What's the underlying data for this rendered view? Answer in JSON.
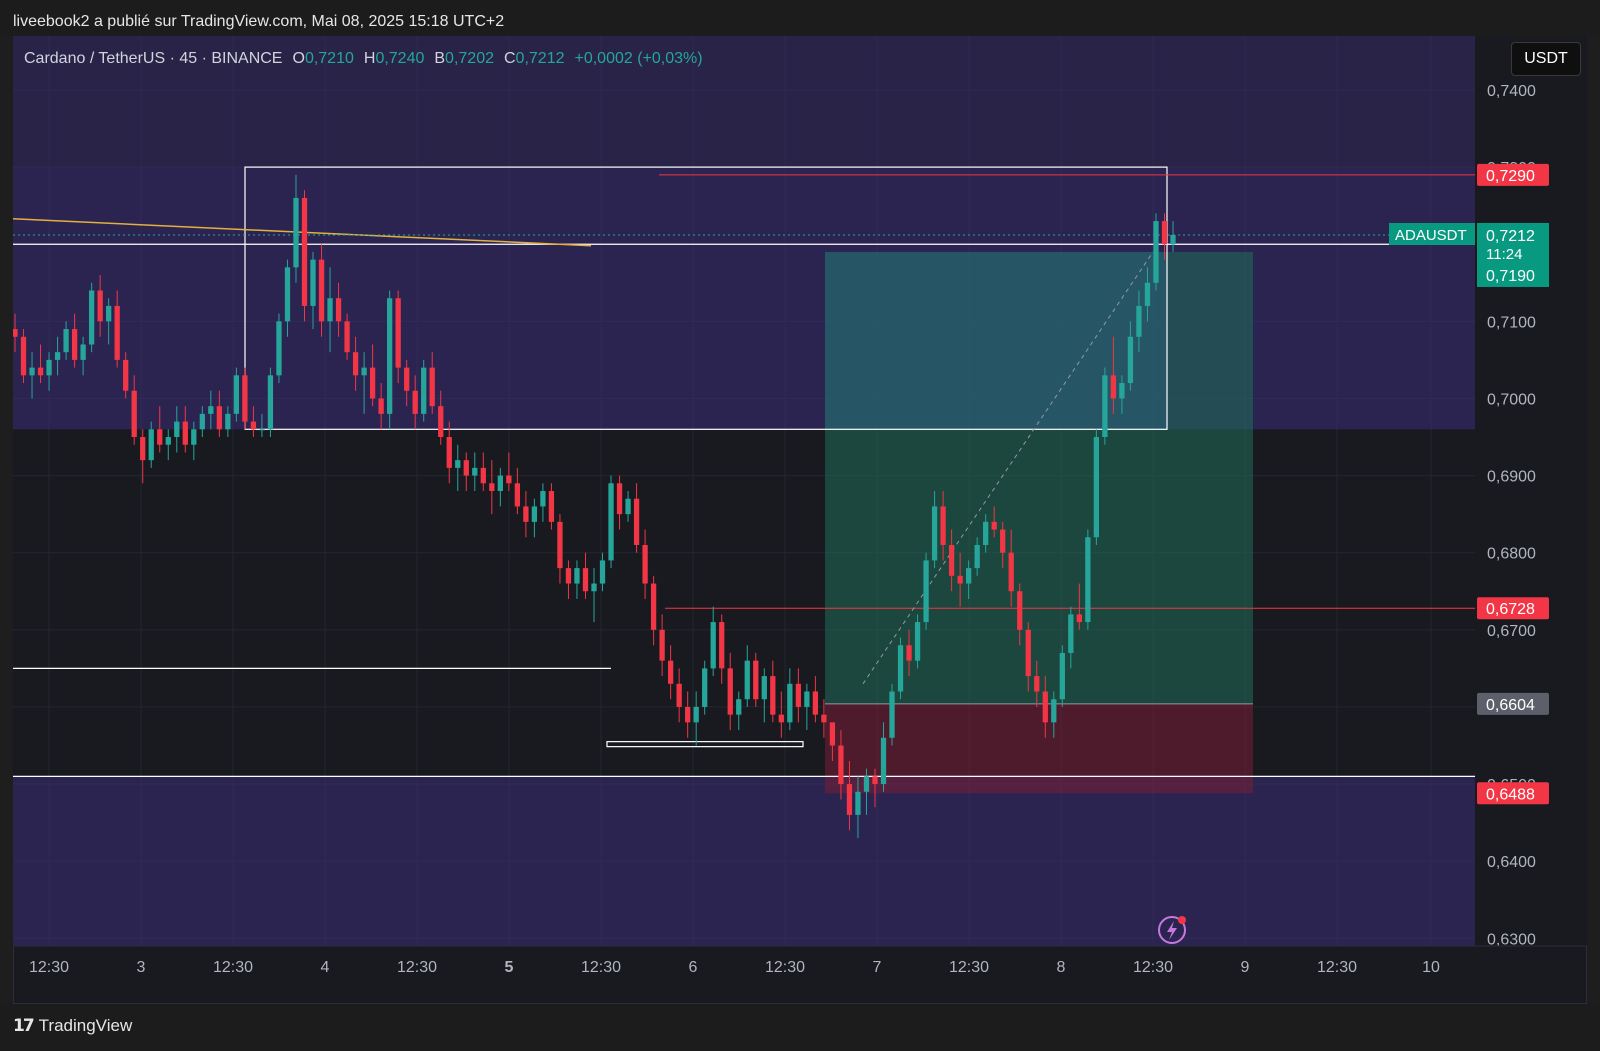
{
  "header": {
    "publisher_line": "liveebook2 a publié sur TradingView.com, Mai 08, 2025 15:18 UTC+2"
  },
  "legend": {
    "symbol": "Cardano / TetherUS · 45 · BINANCE",
    "open_label": "O",
    "open": "0,7210",
    "high_label": "H",
    "high": "0,7240",
    "low_label": "B",
    "low": "0,7202",
    "close_label": "C",
    "close": "0,7212",
    "change": "+0,0002 (+0,03%)"
  },
  "currency_button": "USDT",
  "footer": {
    "brand": "TradingView"
  },
  "colors": {
    "up": "#26a69a",
    "down": "#f23645",
    "zone_purple": "#3d2e7a",
    "tp_green": "#1f6e58",
    "sl_red": "#7a1e35"
  },
  "chart_data": {
    "type": "candlestick",
    "symbol": "ADAUSDT",
    "ylim": [
      0.629,
      0.747
    ],
    "y_ticks": [
      "0,7400",
      "0,7300",
      "0,7100",
      "0,7000",
      "0,6900",
      "0,6800",
      "0,6700",
      "0,6500",
      "0,6400",
      "0,6300"
    ],
    "x_ticks": [
      "12:30",
      "3",
      "12:30",
      "4",
      "12:30",
      "5",
      "12:30",
      "6",
      "12:30",
      "7",
      "12:30",
      "8",
      "12:30",
      "9",
      "12:30",
      "10"
    ],
    "bold_x_ticks": [
      "5"
    ],
    "price_labels": [
      {
        "text": "0,7290",
        "value": 0.729,
        "style": "red"
      },
      {
        "text": "0,6728",
        "value": 0.6728,
        "style": "red"
      },
      {
        "text": "0,6604",
        "value": 0.6604,
        "style": "gray"
      },
      {
        "text": "0,6488",
        "value": 0.6488,
        "style": "red"
      }
    ],
    "current": {
      "symbol_label": "ADAUSDT",
      "price": "0,7212",
      "value": 0.7212,
      "countdown": "11:24",
      "bid": "0,7190"
    },
    "candles": [
      [
        0.709,
        0.711,
        0.706,
        0.708
      ],
      [
        0.708,
        0.709,
        0.702,
        0.703
      ],
      [
        0.703,
        0.706,
        0.7,
        0.704
      ],
      [
        0.704,
        0.707,
        0.702,
        0.703
      ],
      [
        0.703,
        0.706,
        0.701,
        0.705
      ],
      [
        0.705,
        0.708,
        0.703,
        0.706
      ],
      [
        0.706,
        0.71,
        0.705,
        0.709
      ],
      [
        0.709,
        0.711,
        0.704,
        0.705
      ],
      [
        0.705,
        0.708,
        0.703,
        0.707
      ],
      [
        0.707,
        0.715,
        0.706,
        0.714
      ],
      [
        0.714,
        0.716,
        0.708,
        0.71
      ],
      [
        0.71,
        0.713,
        0.707,
        0.712
      ],
      [
        0.712,
        0.714,
        0.704,
        0.705
      ],
      [
        0.705,
        0.706,
        0.7,
        0.701
      ],
      [
        0.701,
        0.703,
        0.694,
        0.695
      ],
      [
        0.695,
        0.696,
        0.689,
        0.692
      ],
      [
        0.692,
        0.697,
        0.691,
        0.696
      ],
      [
        0.696,
        0.699,
        0.693,
        0.694
      ],
      [
        0.694,
        0.696,
        0.692,
        0.695
      ],
      [
        0.695,
        0.699,
        0.693,
        0.697
      ],
      [
        0.697,
        0.699,
        0.693,
        0.694
      ],
      [
        0.694,
        0.697,
        0.692,
        0.696
      ],
      [
        0.696,
        0.699,
        0.695,
        0.698
      ],
      [
        0.698,
        0.701,
        0.696,
        0.699
      ],
      [
        0.699,
        0.701,
        0.695,
        0.696
      ],
      [
        0.696,
        0.699,
        0.695,
        0.698
      ],
      [
        0.698,
        0.704,
        0.697,
        0.703
      ],
      [
        0.703,
        0.704,
        0.696,
        0.697
      ],
      [
        0.697,
        0.699,
        0.695,
        0.696
      ],
      [
        0.696,
        0.698,
        0.695,
        0.696
      ],
      [
        0.696,
        0.704,
        0.695,
        0.703
      ],
      [
        0.703,
        0.711,
        0.702,
        0.71
      ],
      [
        0.71,
        0.718,
        0.708,
        0.717
      ],
      [
        0.717,
        0.729,
        0.715,
        0.726
      ],
      [
        0.726,
        0.727,
        0.71,
        0.712
      ],
      [
        0.712,
        0.719,
        0.709,
        0.718
      ],
      [
        0.718,
        0.72,
        0.708,
        0.71
      ],
      [
        0.71,
        0.717,
        0.706,
        0.713
      ],
      [
        0.713,
        0.715,
        0.708,
        0.71
      ],
      [
        0.71,
        0.711,
        0.705,
        0.706
      ],
      [
        0.706,
        0.708,
        0.701,
        0.703
      ],
      [
        0.703,
        0.706,
        0.698,
        0.704
      ],
      [
        0.704,
        0.707,
        0.699,
        0.7
      ],
      [
        0.7,
        0.702,
        0.696,
        0.698
      ],
      [
        0.698,
        0.714,
        0.696,
        0.713
      ],
      [
        0.713,
        0.714,
        0.702,
        0.704
      ],
      [
        0.704,
        0.705,
        0.699,
        0.701
      ],
      [
        0.701,
        0.703,
        0.696,
        0.698
      ],
      [
        0.698,
        0.705,
        0.697,
        0.704
      ],
      [
        0.704,
        0.706,
        0.698,
        0.699
      ],
      [
        0.699,
        0.701,
        0.694,
        0.695
      ],
      [
        0.695,
        0.697,
        0.689,
        0.691
      ],
      [
        0.691,
        0.694,
        0.688,
        0.692
      ],
      [
        0.692,
        0.693,
        0.688,
        0.69
      ],
      [
        0.69,
        0.693,
        0.688,
        0.691
      ],
      [
        0.691,
        0.693,
        0.688,
        0.689
      ],
      [
        0.689,
        0.692,
        0.685,
        0.688
      ],
      [
        0.688,
        0.691,
        0.686,
        0.69
      ],
      [
        0.69,
        0.693,
        0.688,
        0.689
      ],
      [
        0.689,
        0.691,
        0.685,
        0.686
      ],
      [
        0.686,
        0.688,
        0.682,
        0.684
      ],
      [
        0.684,
        0.687,
        0.682,
        0.686
      ],
      [
        0.686,
        0.689,
        0.684,
        0.688
      ],
      [
        0.688,
        0.689,
        0.683,
        0.684
      ],
      [
        0.684,
        0.685,
        0.676,
        0.678
      ],
      [
        0.678,
        0.679,
        0.674,
        0.676
      ],
      [
        0.676,
        0.679,
        0.674,
        0.678
      ],
      [
        0.678,
        0.68,
        0.674,
        0.675
      ],
      [
        0.675,
        0.678,
        0.671,
        0.676
      ],
      [
        0.676,
        0.68,
        0.675,
        0.679
      ],
      [
        0.679,
        0.69,
        0.678,
        0.689
      ],
      [
        0.689,
        0.69,
        0.683,
        0.685
      ],
      [
        0.685,
        0.688,
        0.684,
        0.687
      ],
      [
        0.687,
        0.689,
        0.68,
        0.681
      ],
      [
        0.681,
        0.683,
        0.674,
        0.676
      ],
      [
        0.676,
        0.677,
        0.668,
        0.67
      ],
      [
        0.67,
        0.672,
        0.664,
        0.666
      ],
      [
        0.666,
        0.668,
        0.661,
        0.663
      ],
      [
        0.663,
        0.665,
        0.658,
        0.66
      ],
      [
        0.66,
        0.662,
        0.656,
        0.658
      ],
      [
        0.658,
        0.662,
        0.655,
        0.66
      ],
      [
        0.66,
        0.666,
        0.659,
        0.665
      ],
      [
        0.665,
        0.673,
        0.664,
        0.671
      ],
      [
        0.671,
        0.672,
        0.663,
        0.665
      ],
      [
        0.665,
        0.667,
        0.657,
        0.659
      ],
      [
        0.659,
        0.662,
        0.657,
        0.661
      ],
      [
        0.661,
        0.668,
        0.66,
        0.666
      ],
      [
        0.666,
        0.667,
        0.66,
        0.661
      ],
      [
        0.661,
        0.665,
        0.658,
        0.664
      ],
      [
        0.664,
        0.666,
        0.658,
        0.659
      ],
      [
        0.659,
        0.662,
        0.656,
        0.658
      ],
      [
        0.658,
        0.665,
        0.657,
        0.663
      ],
      [
        0.663,
        0.665,
        0.658,
        0.66
      ],
      [
        0.66,
        0.663,
        0.657,
        0.662
      ],
      [
        0.662,
        0.664,
        0.658,
        0.659
      ],
      [
        0.659,
        0.661,
        0.656,
        0.658
      ],
      [
        0.658,
        0.656,
        0.653,
        0.655
      ],
      [
        0.655,
        0.657,
        0.648,
        0.65
      ],
      [
        0.65,
        0.653,
        0.644,
        0.646
      ],
      [
        0.646,
        0.651,
        0.643,
        0.649
      ],
      [
        0.649,
        0.652,
        0.646,
        0.651
      ],
      [
        0.651,
        0.652,
        0.647,
        0.65
      ],
      [
        0.65,
        0.658,
        0.649,
        0.656
      ],
      [
        0.656,
        0.663,
        0.655,
        0.662
      ],
      [
        0.662,
        0.669,
        0.661,
        0.668
      ],
      [
        0.668,
        0.67,
        0.664,
        0.666
      ],
      [
        0.666,
        0.672,
        0.665,
        0.671
      ],
      [
        0.671,
        0.68,
        0.67,
        0.679
      ],
      [
        0.679,
        0.688,
        0.678,
        0.686
      ],
      [
        0.686,
        0.688,
        0.679,
        0.681
      ],
      [
        0.681,
        0.683,
        0.675,
        0.677
      ],
      [
        0.677,
        0.68,
        0.673,
        0.676
      ],
      [
        0.676,
        0.679,
        0.674,
        0.678
      ],
      [
        0.678,
        0.682,
        0.677,
        0.681
      ],
      [
        0.681,
        0.685,
        0.68,
        0.684
      ],
      [
        0.684,
        0.686,
        0.682,
        0.683
      ],
      [
        0.683,
        0.684,
        0.678,
        0.68
      ],
      [
        0.68,
        0.683,
        0.673,
        0.675
      ],
      [
        0.675,
        0.676,
        0.668,
        0.67
      ],
      [
        0.67,
        0.671,
        0.662,
        0.664
      ],
      [
        0.664,
        0.666,
        0.66,
        0.662
      ],
      [
        0.662,
        0.664,
        0.656,
        0.658
      ],
      [
        0.658,
        0.662,
        0.656,
        0.661
      ],
      [
        0.661,
        0.668,
        0.66,
        0.667
      ],
      [
        0.667,
        0.673,
        0.665,
        0.672
      ],
      [
        0.672,
        0.676,
        0.67,
        0.671
      ],
      [
        0.671,
        0.683,
        0.67,
        0.682
      ],
      [
        0.682,
        0.696,
        0.681,
        0.695
      ],
      [
        0.695,
        0.704,
        0.694,
        0.703
      ],
      [
        0.703,
        0.708,
        0.698,
        0.7
      ],
      [
        0.7,
        0.703,
        0.698,
        0.702
      ],
      [
        0.702,
        0.71,
        0.701,
        0.708
      ],
      [
        0.708,
        0.714,
        0.706,
        0.712
      ],
      [
        0.712,
        0.717,
        0.71,
        0.715
      ],
      [
        0.715,
        0.724,
        0.714,
        0.723
      ],
      [
        0.723,
        0.724,
        0.718,
        0.72
      ],
      [
        0.72,
        0.723,
        0.719,
        0.7212
      ]
    ],
    "ranges": [
      {
        "name": "supply-zone",
        "y_top": 0.73,
        "y_bottom": 0.696
      },
      {
        "name": "demand-zone",
        "y_top": 0.651,
        "y_bottom": 0.629
      },
      {
        "name": "take-profit-zone",
        "y_top": 0.719,
        "y_bottom": 0.6604
      },
      {
        "name": "stop-loss-zone",
        "y_top": 0.6604,
        "y_bottom": 0.6488
      }
    ]
  }
}
